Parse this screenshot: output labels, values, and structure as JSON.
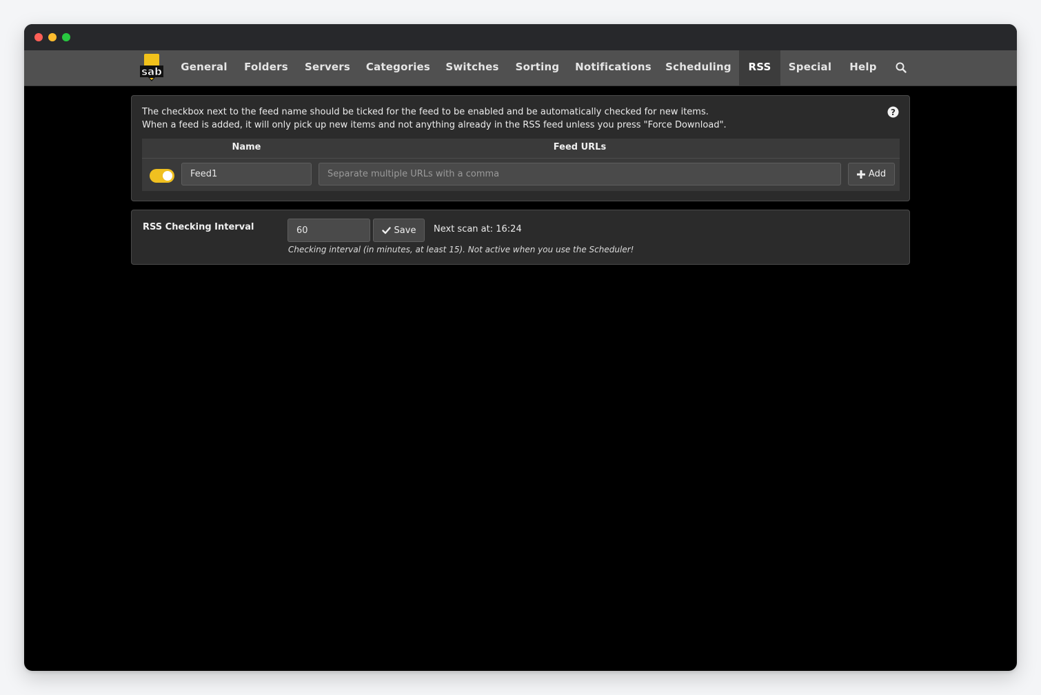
{
  "nav": {
    "items": [
      {
        "label": "General"
      },
      {
        "label": "Folders"
      },
      {
        "label": "Servers"
      },
      {
        "label": "Categories"
      },
      {
        "label": "Switches"
      },
      {
        "label": "Sorting"
      },
      {
        "label": "Notifications"
      },
      {
        "label": "Scheduling"
      },
      {
        "label": "RSS",
        "active": true
      },
      {
        "label": "Special"
      },
      {
        "label": "Help"
      }
    ],
    "logo_text": "sab",
    "search_icon": "search-icon"
  },
  "rss": {
    "info_line1": "The checkbox next to the feed name should be ticked for the feed to be enabled and be automatically checked for new items.",
    "info_line2": "When a feed is added, it will only pick up new items and not anything already in the RSS feed unless you press \"Force Download\".",
    "help_icon": "question-circle-icon",
    "table": {
      "col_name": "Name",
      "col_urls": "Feed URLs"
    },
    "new_feed": {
      "enabled": true,
      "name_value": "Feed1",
      "url_placeholder": "Separate multiple URLs with a comma",
      "add_label": "Add"
    }
  },
  "interval": {
    "label": "RSS Checking Interval",
    "value": "60",
    "save_label": "Save",
    "next_scan": "Next scan at: 16:24",
    "hint": "Checking interval (in minutes, at least 15). Not active when you use the Scheduler!"
  },
  "colors": {
    "accent": "#f0c020",
    "navbar": "#505050",
    "panel": "#2b2b2b",
    "background": "#000000"
  }
}
